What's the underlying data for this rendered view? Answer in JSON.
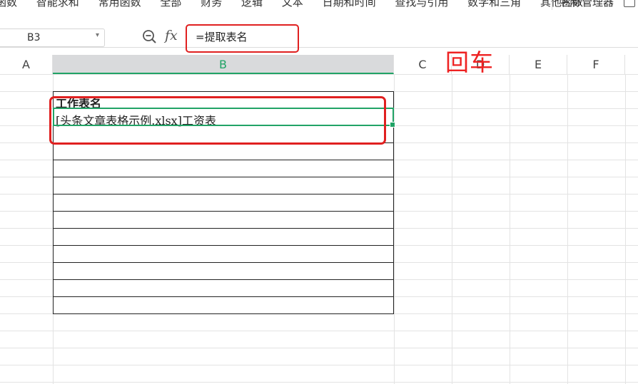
{
  "ribbon": {
    "items": [
      "函数",
      "智能求和",
      "常用函数",
      "全部",
      "财务",
      "逻辑",
      "文本",
      "日期和时间",
      "查找与引用",
      "数学和三角",
      "其他函数"
    ],
    "name_manager": "名称管理器"
  },
  "formula_bar": {
    "name_box": "B3",
    "formula": "=提取表名",
    "fx_label": "fx"
  },
  "columns": [
    {
      "id": "A",
      "label": "A"
    },
    {
      "id": "B",
      "label": "B",
      "selected": true
    },
    {
      "id": "C",
      "label": "C"
    },
    {
      "id": "D",
      "label": "D"
    },
    {
      "id": "E",
      "label": "E"
    },
    {
      "id": "F",
      "label": "F"
    }
  ],
  "cells": {
    "b2": "工作表名",
    "b3": "[头条文章表格示例.xlsx]工资表"
  },
  "annotation": {
    "text": "回车",
    "color": "#e22222"
  },
  "colors": {
    "accent": "#21a366",
    "highlight": "#e02020"
  }
}
